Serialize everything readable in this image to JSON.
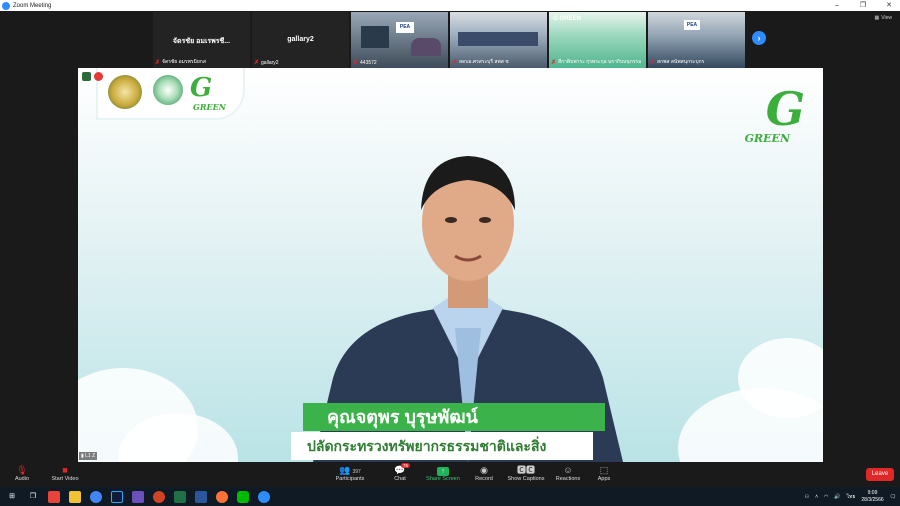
{
  "window": {
    "title": "Zoom Meeting",
    "controls": [
      "–",
      "❐",
      "✕"
    ]
  },
  "view_button": {
    "label": "View"
  },
  "gallery": {
    "tiles": [
      {
        "name": "จัดรชัย อมเรพรชี...",
        "footer": "จัดรชัย อมรพรมิยกส"
      },
      {
        "name": "gallary2",
        "footer": "gallary2"
      },
      {
        "footer": "443572"
      },
      {
        "footer": "สดบอ.ศรสระบุรี สพส ช"
      },
      {
        "footer": "สีกาดิบพาระ กุรพระกุอ นรากิบบนุกรรม"
      },
      {
        "footer": "สกพส สนัพสนุกระบุกร"
      }
    ],
    "tile3_sign": "PEA",
    "tile5_brand": "G·GREEN",
    "tile6_sign": "PEA"
  },
  "main_video": {
    "logo_small_text": "GREEN",
    "logo_big_text": "GREEN",
    "speaker_name": "คุณจตุพร บุรุษพัฒน์",
    "speaker_title": "ปลัดกระทรวงทรัพยากรธรรมชาติและสิ่งแวดล้อม",
    "signal_label": "L1 Z"
  },
  "toolbar": {
    "audio": "Audio",
    "start_video": "Start Video",
    "participants": "Participants",
    "participants_count": "397",
    "chat": "Chat",
    "chat_badge": "76",
    "share_screen": "Share Screen",
    "record": "Record",
    "captions": "Show Captions",
    "reactions": "Reactions",
    "apps": "Apps",
    "leave": "Leave"
  },
  "taskbar": {
    "time": "9:09",
    "date": "28/3/2566",
    "lang": "ไทย"
  },
  "colors": {
    "zoom_blue": "#2d8cff",
    "green_brand": "#3cb34a",
    "leave_red": "#e02828"
  }
}
